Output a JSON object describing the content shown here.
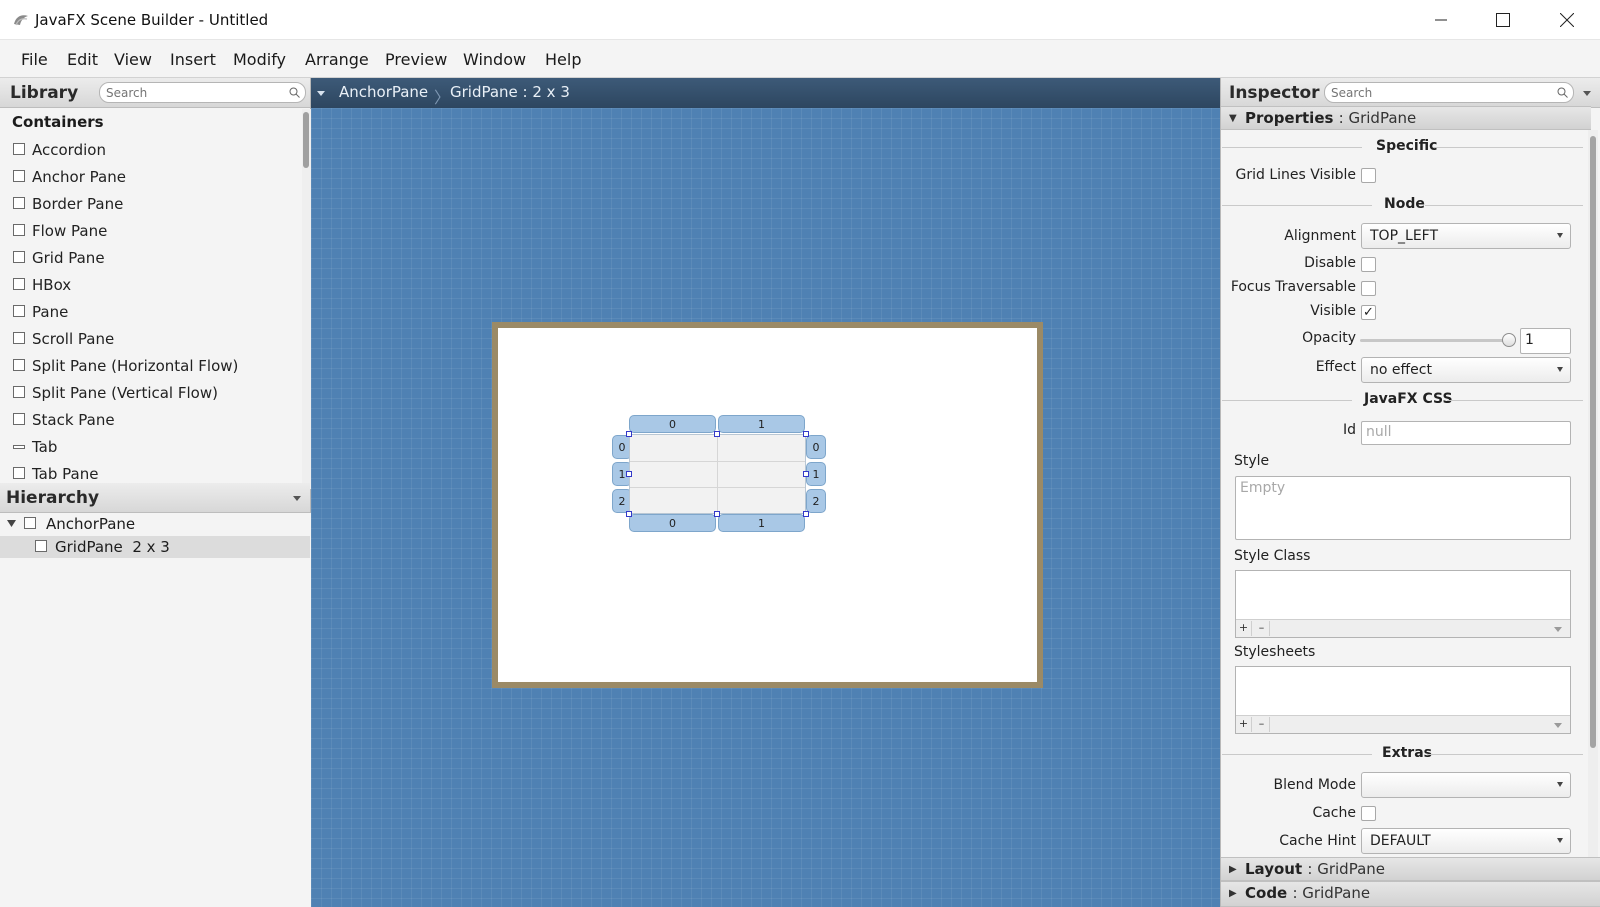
{
  "window": {
    "title": "JavaFX Scene Builder - Untitled"
  },
  "menu": [
    "File",
    "Edit",
    "View",
    "Insert",
    "Modify",
    "Arrange",
    "Preview",
    "Window",
    "Help"
  ],
  "library": {
    "title": "Library",
    "search_placeholder": "Search",
    "section": "Containers",
    "items": [
      "Accordion",
      "Anchor Pane",
      "Border Pane",
      "Flow Pane",
      "Grid Pane",
      "HBox",
      "Pane",
      "Scroll Pane",
      "Split Pane (Horizontal Flow)",
      "Split Pane (Vertical Flow)",
      "Stack Pane",
      "Tab",
      "Tab Pane"
    ]
  },
  "hierarchy": {
    "title": "Hierarchy",
    "items": [
      {
        "label": "AnchorPane",
        "expanded": true
      },
      {
        "label": "GridPane  2 x 3",
        "selected": true
      }
    ]
  },
  "breadcrumb": [
    "AnchorPane",
    "GridPane : 2 x 3"
  ],
  "gridpane": {
    "columns": [
      "0",
      "1"
    ],
    "rows": [
      "0",
      "1",
      "2"
    ]
  },
  "inspector": {
    "title": "Inspector",
    "search_placeholder": "Search",
    "properties_label": "Properties",
    "properties_target": ": GridPane",
    "specific_title": "Specific",
    "grid_lines_visible_label": "Grid Lines Visible",
    "node_title": "Node",
    "alignment_label": "Alignment",
    "alignment_value": "TOP_LEFT",
    "disable_label": "Disable",
    "focus_traversable_label": "Focus Traversable",
    "visible_label": "Visible",
    "visible_checked": true,
    "opacity_label": "Opacity",
    "opacity_value": "1",
    "effect_label": "Effect",
    "effect_value": "no effect",
    "css_title": "JavaFX CSS",
    "id_label": "Id",
    "id_placeholder": "null",
    "style_label": "Style",
    "style_placeholder": "Empty",
    "style_class_label": "Style Class",
    "stylesheets_label": "Stylesheets",
    "extras_title": "Extras",
    "blend_mode_label": "Blend Mode",
    "cache_label": "Cache",
    "cache_hint_label": "Cache Hint",
    "cache_hint_value": "DEFAULT",
    "layout_label": "Layout",
    "layout_target": ": GridPane",
    "code_label": "Code",
    "code_target": ": GridPane"
  },
  "colors": {
    "canvas": "#4f81b3",
    "breadcrumb_bar": "#2d4660",
    "anchor_border": "#9b8a66",
    "grid_tab": "#a9c8e6",
    "handle": "#3339c9"
  }
}
